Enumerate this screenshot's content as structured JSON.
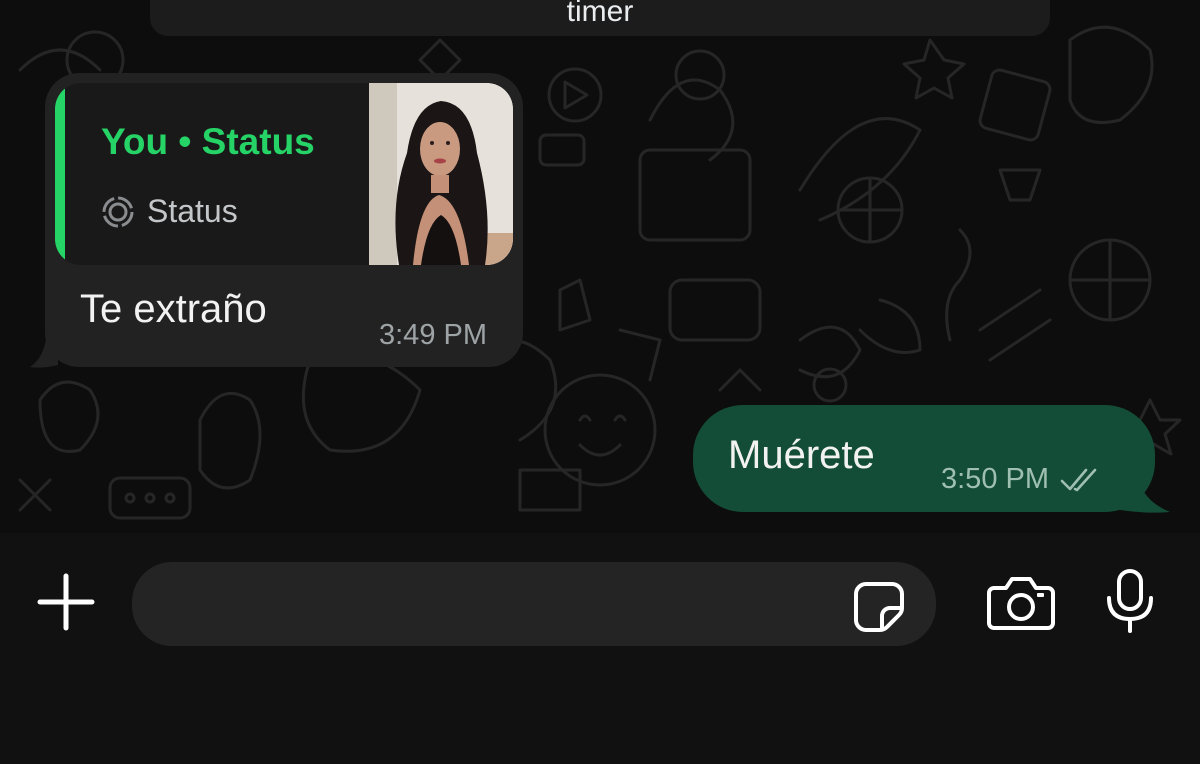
{
  "system_message": {
    "text": "timer"
  },
  "incoming": {
    "quote_author": "You",
    "quote_separator": "•",
    "quote_type": "Status",
    "quote_label": "Status",
    "text": "Te extraño",
    "time": "3:49 PM"
  },
  "outgoing": {
    "text": "Muérete",
    "time": "3:50 PM",
    "receipt": "double-check-icon"
  },
  "composer": {
    "input_value": "",
    "icons": [
      "plus-icon",
      "sticker-icon",
      "camera-icon",
      "microphone-icon"
    ]
  },
  "colors": {
    "accent": "#25d366",
    "incoming_bubble": "#222222",
    "outgoing_bubble": "#144d37",
    "background": "#0d0d0d"
  }
}
